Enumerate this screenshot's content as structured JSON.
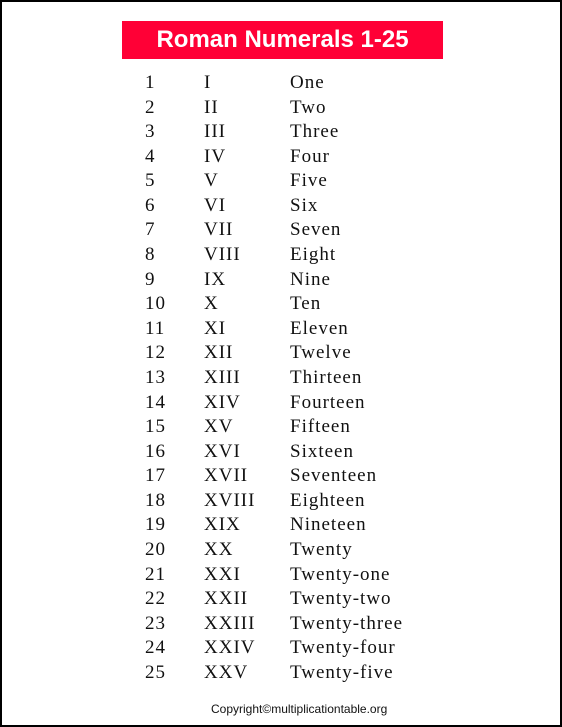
{
  "title": "Roman Numerals 1-25",
  "rows": [
    [
      "1",
      "I",
      "One"
    ],
    [
      "2",
      "II",
      "Two"
    ],
    [
      "3",
      "III",
      "Three"
    ],
    [
      "4",
      "IV",
      "Four"
    ],
    [
      "5",
      "V",
      "Five"
    ],
    [
      "6",
      "VI",
      "Six"
    ],
    [
      "7",
      "VII",
      "Seven"
    ],
    [
      "8",
      "VIII",
      "Eight"
    ],
    [
      "9",
      "IX",
      "Nine"
    ],
    [
      "10",
      "X",
      "Ten"
    ],
    [
      "11",
      "XI",
      "Eleven"
    ],
    [
      "12",
      "XII",
      "Twelve"
    ],
    [
      "13",
      "XIII",
      "Thirteen"
    ],
    [
      "14",
      "XIV",
      "Fourteen"
    ],
    [
      "15",
      "XV",
      "Fifteen"
    ],
    [
      "16",
      "XVI",
      "Sixteen"
    ],
    [
      "17",
      "XVII",
      "Seventeen"
    ],
    [
      "18",
      "XVIII",
      "Eighteen"
    ],
    [
      "19",
      "XIX",
      "Nineteen"
    ],
    [
      "20",
      "XX",
      "Twenty"
    ],
    [
      "21",
      "XXI",
      "Twenty-one"
    ],
    [
      "22",
      "XXII",
      "Twenty-two"
    ],
    [
      "23",
      "XXIII",
      "Twenty-three"
    ],
    [
      "24",
      "XXIV",
      "Twenty-four"
    ],
    [
      "25",
      "XXV",
      "Twenty-five"
    ]
  ],
  "footer": "Copyright©multiplicationtable.org",
  "colors": {
    "title_bg": "#ff0036",
    "title_text": "#ffffff"
  }
}
